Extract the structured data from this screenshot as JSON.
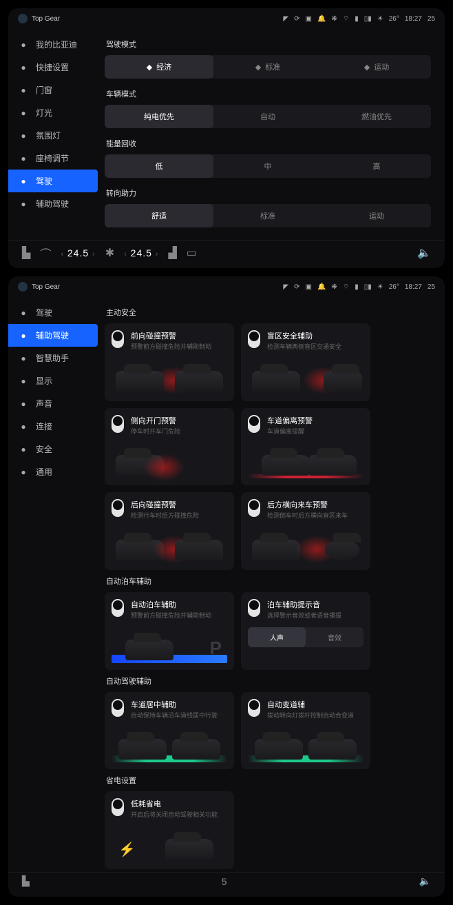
{
  "status": {
    "title": "Top Gear",
    "weather": "26°",
    "time": "18:27",
    "range": "25"
  },
  "panel1": {
    "nav": [
      {
        "icon": "car",
        "label": "我的比亚迪"
      },
      {
        "icon": "settings-quick",
        "label": "快捷设置"
      },
      {
        "icon": "window",
        "label": "门窗"
      },
      {
        "icon": "light",
        "label": "灯光"
      },
      {
        "icon": "ambient",
        "label": "氛围灯"
      },
      {
        "icon": "seat",
        "label": "座椅调节"
      },
      {
        "icon": "wheel",
        "label": "驾驶",
        "active": true
      },
      {
        "icon": "adas",
        "label": "辅助驾驶"
      }
    ],
    "sections": [
      {
        "label": "驾驶模式",
        "options": [
          {
            "icon": "car",
            "label": "经济",
            "sel": true
          },
          {
            "icon": "flag",
            "label": "标准"
          },
          {
            "icon": "leaf",
            "label": "运动"
          }
        ]
      },
      {
        "label": "车辆模式",
        "options": [
          {
            "label": "纯电优先",
            "sel": true
          },
          {
            "label": "自动"
          },
          {
            "label": "燃油优先"
          }
        ]
      },
      {
        "label": "能量回收",
        "options": [
          {
            "label": "低",
            "sel": true
          },
          {
            "label": "中"
          },
          {
            "label": "高"
          }
        ]
      },
      {
        "label": "转向助力",
        "options": [
          {
            "label": "舒适",
            "sel": true
          },
          {
            "label": "标准"
          },
          {
            "label": "运动"
          }
        ]
      }
    ],
    "bottom": {
      "temp_left": "24.5",
      "temp_right": "24.5"
    }
  },
  "panel2": {
    "nav": [
      {
        "icon": "wheel",
        "label": "驾驶"
      },
      {
        "icon": "adas",
        "label": "辅助驾驶",
        "active": true
      },
      {
        "icon": "assistant",
        "label": "智慧助手"
      },
      {
        "icon": "display",
        "label": "显示"
      },
      {
        "icon": "sound",
        "label": "声音"
      },
      {
        "icon": "link",
        "label": "连接"
      },
      {
        "icon": "shield",
        "label": "安全"
      },
      {
        "icon": "sliders",
        "label": "通用"
      }
    ],
    "groups": [
      {
        "label": "主动安全",
        "cards": [
          {
            "title": "前向碰撞预警",
            "sub": "预警前方碰撞危险并辅助制动",
            "illus": "front-red"
          },
          {
            "title": "盲区安全辅助",
            "sub": "检测车辆两侧盲区交通安全",
            "illus": "blind-red"
          },
          {
            "title": "侧向开门预警",
            "sub": "停车时开车门危险",
            "illus": "door-red"
          },
          {
            "title": "车道偏离预警",
            "sub": "车道偏离提醒",
            "illus": "lane-red"
          },
          {
            "title": "后向碰撞预警",
            "sub": "检测行车时后方碰撞危险",
            "illus": "rear-red"
          },
          {
            "title": "后方横向来车预警",
            "sub": "检测倒车时后方横向盲区来车",
            "illus": "cross-red"
          }
        ]
      },
      {
        "label": "自动泊车辅助",
        "cards": [
          {
            "title": "自动泊车辅助",
            "sub": "预警前方碰撞危险并辅助制动",
            "illus": "parking"
          },
          {
            "title": "泊车辅助提示音",
            "sub": "选择警示音效或者语音播报",
            "seg": {
              "options": [
                "人声",
                "音效"
              ],
              "sel": 0
            }
          }
        ]
      },
      {
        "label": "自动驾驶辅助",
        "cards": [
          {
            "title": "车道居中辅助",
            "sub": "自动保持车辆沿车道线居中行驶",
            "illus": "lane-green"
          },
          {
            "title": "自动变道辅",
            "sub": "拨动转向灯拨杆控制自动合变道",
            "illus": "lane-change"
          }
        ]
      },
      {
        "label": "省电设置",
        "cards": [
          {
            "title": "低耗省电",
            "sub": "开启后将关闭自动驾驶相关功能",
            "illus": "eco"
          }
        ]
      }
    ],
    "bottom_num": "5"
  }
}
